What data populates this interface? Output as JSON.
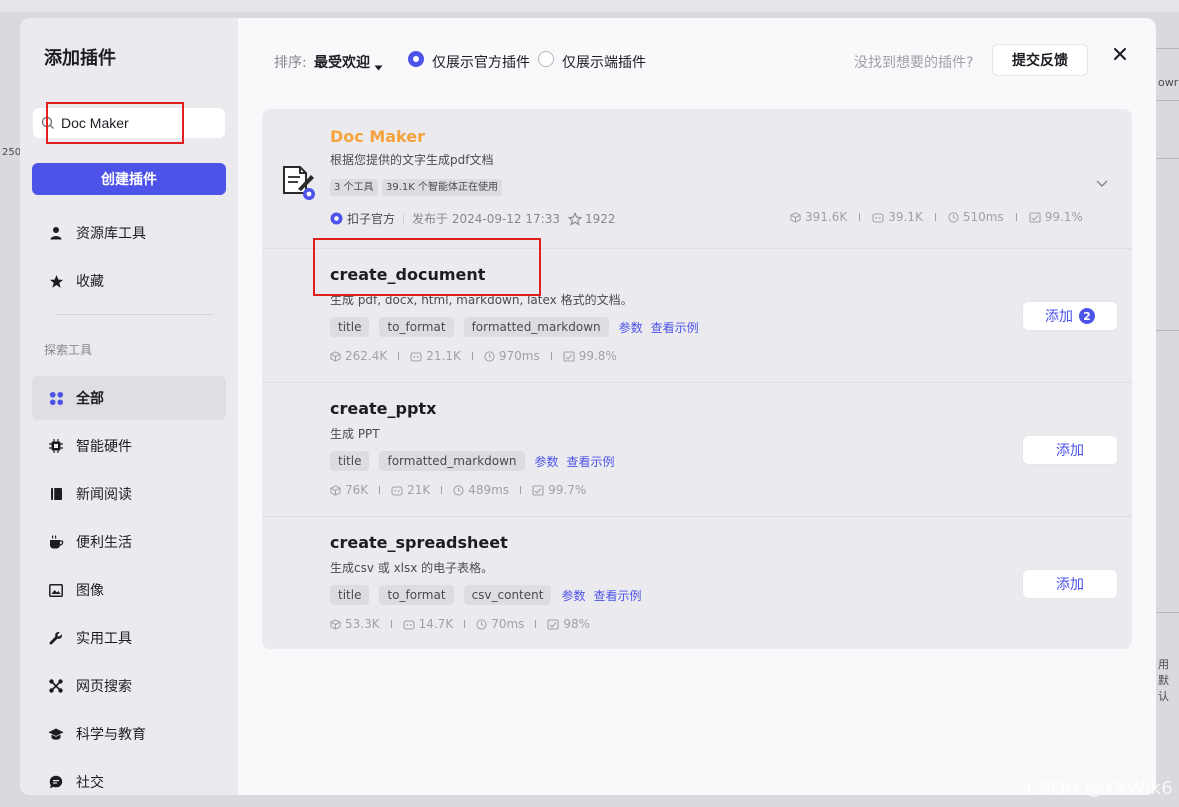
{
  "background": {
    "snippets": [
      "owr",
      "250",
      "用默认"
    ]
  },
  "sidebar": {
    "title": "添加插件",
    "search_value": "Doc Maker",
    "create_label": "创建插件",
    "items_top": [
      {
        "label": "资源库工具",
        "icon": "user-icon"
      },
      {
        "label": "收藏",
        "icon": "star-icon"
      }
    ],
    "section_label": "探索工具",
    "categories": [
      {
        "label": "全部",
        "icon": "grid-icon",
        "active": true
      },
      {
        "label": "智能硬件",
        "icon": "chip-icon"
      },
      {
        "label": "新闻阅读",
        "icon": "book-icon"
      },
      {
        "label": "便利生活",
        "icon": "cup-icon"
      },
      {
        "label": "图像",
        "icon": "image-icon"
      },
      {
        "label": "实用工具",
        "icon": "wrench-icon"
      },
      {
        "label": "网页搜索",
        "icon": "network-icon"
      },
      {
        "label": "科学与教育",
        "icon": "graduation-cap-icon"
      },
      {
        "label": "社交",
        "icon": "chat-icon"
      }
    ]
  },
  "toolbar": {
    "sort_label": "排序:",
    "sort_value": "最受欢迎",
    "radio_official": "仅展示官方插件",
    "radio_client": "仅展示端插件",
    "hint": "没找到想要的插件?",
    "feedback_label": "提交反馈"
  },
  "plugin": {
    "name": "Doc Maker",
    "description": "根据您提供的文字生成pdf文档",
    "tags": [
      "3 个工具",
      "39.1K 个智能体正在使用"
    ],
    "publisher": "扣子官方",
    "published": "发布于 2024-09-12 17:33",
    "stars": "1922",
    "stats": {
      "calls": "391.6K",
      "bots": "39.1K",
      "latency": "510ms",
      "success": "99.1%"
    }
  },
  "tools": [
    {
      "name": "create_document",
      "description": "生成 pdf, docx, html, markdown, latex 格式的文档。",
      "params": [
        "title",
        "to_format",
        "formatted_markdown"
      ],
      "link_params": "参数",
      "link_example": "查看示例",
      "stats": {
        "calls": "262.4K",
        "bots": "21.1K",
        "latency": "970ms",
        "success": "99.8%"
      },
      "add_label": "添加",
      "badge": "2"
    },
    {
      "name": "create_pptx",
      "description": "生成 PPT",
      "params": [
        "title",
        "formatted_markdown"
      ],
      "link_params": "参数",
      "link_example": "查看示例",
      "stats": {
        "calls": "76K",
        "bots": "21K",
        "latency": "489ms",
        "success": "99.7%"
      },
      "add_label": "添加"
    },
    {
      "name": "create_spreadsheet",
      "description": "生成csv 或 xlsx 的电子表格。",
      "params": [
        "title",
        "to_format",
        "csv_content"
      ],
      "link_params": "参数",
      "link_example": "查看示例",
      "stats": {
        "calls": "53.3K",
        "bots": "14.7K",
        "latency": "70ms",
        "success": "98%"
      },
      "add_label": "添加"
    }
  ],
  "watermark": "CSDN @YXWik6",
  "colors": {
    "accent": "#4d53e8",
    "plugin_name": "#f5a33a",
    "highlight": "#e0201e"
  }
}
